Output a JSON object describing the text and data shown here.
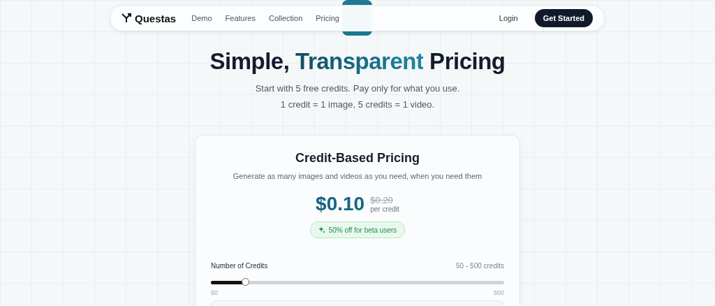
{
  "nav": {
    "brand": "Questas",
    "links": [
      "Demo",
      "Features",
      "Collection",
      "Pricing"
    ],
    "login": "Login",
    "cta": "Get Started"
  },
  "hero": {
    "title_start": "Simple,",
    "title_accent": "Transparent",
    "title_end": "Pricing",
    "lines": [
      "Start with 5 free credits. Pay only for what you use.",
      "1 credit = 1 image, 5 credits = 1 video."
    ]
  },
  "card": {
    "title": "Credit-Based Pricing",
    "subtitle": "Generate as many images and videos as you need, when you need them",
    "price": "$0.10",
    "old_price": "$0.20",
    "unit": "per credit",
    "badge": "50% off for beta users",
    "slider": {
      "label": "Number of Credits",
      "range": "50 - 500 credits",
      "min": "50",
      "max": "500",
      "level": 0.12
    }
  }
}
